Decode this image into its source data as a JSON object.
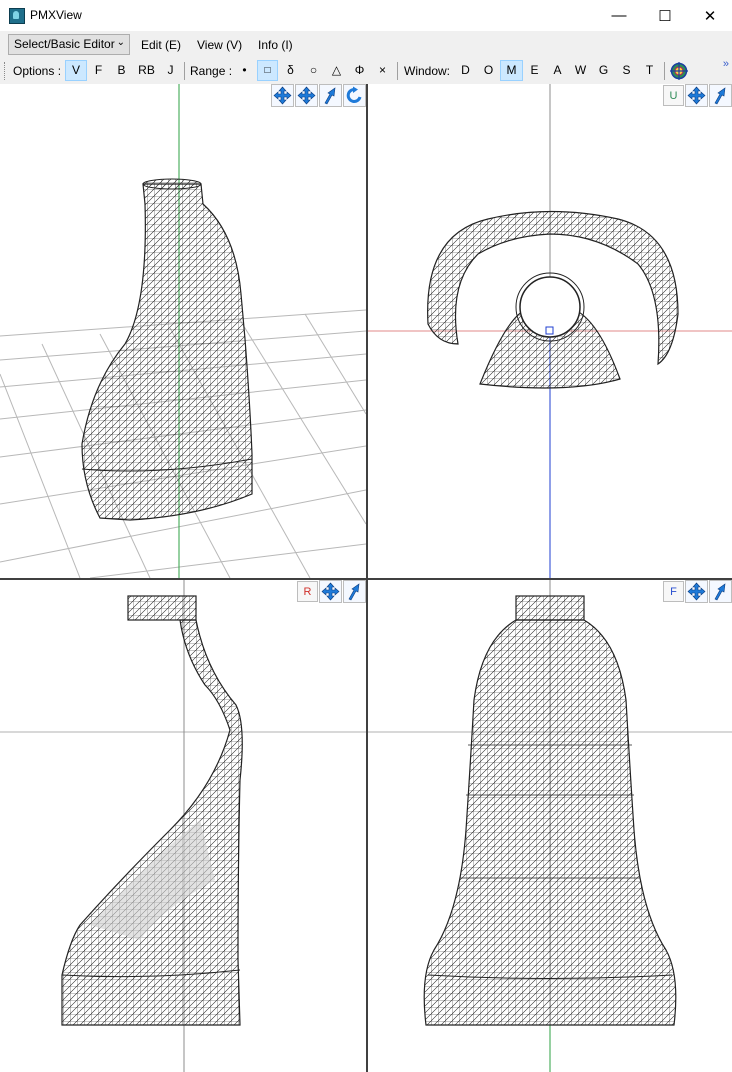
{
  "window": {
    "title": "PMXView",
    "minimize": "—",
    "maximize": "☐",
    "close": "✕"
  },
  "menubar": {
    "editor_select": "Select/Basic Editor",
    "items": [
      "Edit (E)",
      "View (V)",
      "Info (I)"
    ]
  },
  "toolbar": {
    "options_label": "Options :",
    "options": [
      "V",
      "F",
      "B",
      "RB",
      "J"
    ],
    "range_label": "Range :",
    "range_options": [
      "•",
      "□",
      "δ",
      "○",
      "△",
      "Φ",
      "×"
    ],
    "window_label": "Window:",
    "window_options": [
      "D",
      "O",
      "M",
      "E",
      "A",
      "W",
      "G",
      "S",
      "T"
    ],
    "active_option": "V",
    "active_range": "□",
    "active_window": "M",
    "overflow": "»"
  },
  "viewports": {
    "perspective": {
      "name": "perspective"
    },
    "top": {
      "label": "U",
      "label_color": "#2e8b57"
    },
    "side": {
      "label": "R",
      "label_color": "#d0302a"
    },
    "front": {
      "label": "F",
      "label_color": "#2a4fd0"
    }
  },
  "colors": {
    "axis_green": "#2ea043",
    "axis_blue": "#1f3fd1",
    "axis_red": "#e08a8a",
    "grid": "#b8b8b8",
    "mesh": "#1a1a1a",
    "tool_blue": "#1e7ad9"
  }
}
